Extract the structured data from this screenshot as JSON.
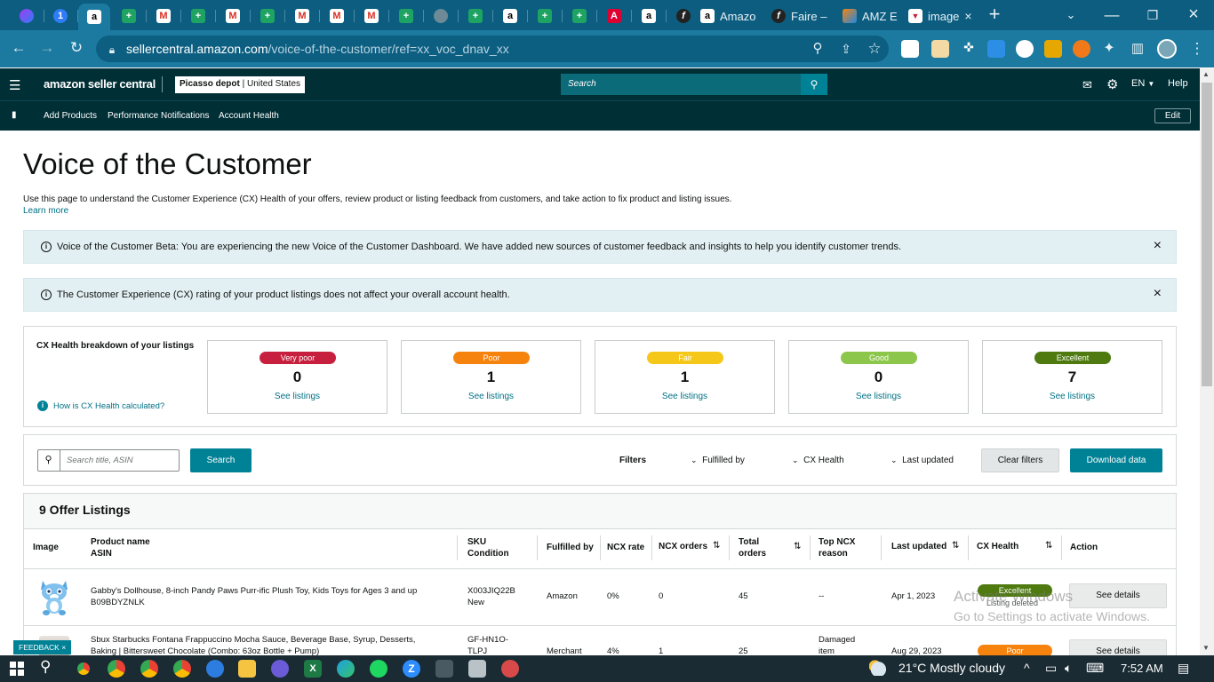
{
  "browser": {
    "tabs": [
      {
        "kind": "icon",
        "icon": "messenger-icon"
      },
      {
        "kind": "icon",
        "icon": "badge-1-icon",
        "text": "1"
      },
      {
        "kind": "icon",
        "icon": "amazon-a-icon",
        "text": "a",
        "active": true
      },
      {
        "kind": "icon",
        "icon": "google-sheets-icon",
        "text": "+"
      },
      {
        "kind": "icon",
        "icon": "gmail-icon",
        "text": "M"
      },
      {
        "kind": "icon",
        "icon": "google-sheets-icon",
        "text": "+"
      },
      {
        "kind": "icon",
        "icon": "gmail-icon",
        "text": "M"
      },
      {
        "kind": "icon",
        "icon": "google-sheets-icon",
        "text": "+"
      },
      {
        "kind": "icon",
        "icon": "gmail-icon",
        "text": "M"
      },
      {
        "kind": "icon",
        "icon": "gmail-icon",
        "text": "M"
      },
      {
        "kind": "icon",
        "icon": "gmail-icon",
        "text": "M"
      },
      {
        "kind": "icon",
        "icon": "google-sheets-icon",
        "text": "+"
      },
      {
        "kind": "icon",
        "icon": "globe-icon"
      },
      {
        "kind": "icon",
        "icon": "google-sheets-icon",
        "text": "+"
      },
      {
        "kind": "icon",
        "icon": "amazon-a-icon",
        "text": "a"
      },
      {
        "kind": "icon",
        "icon": "google-sheets-icon",
        "text": "+"
      },
      {
        "kind": "icon",
        "icon": "google-sheets-icon",
        "text": "+"
      },
      {
        "kind": "icon",
        "icon": "angular-icon",
        "text": "A"
      },
      {
        "kind": "icon",
        "icon": "amazon-a-icon",
        "text": "a"
      },
      {
        "kind": "icon",
        "icon": "faire-f-icon",
        "text": "f"
      }
    ],
    "wide_tabs": [
      {
        "icon": "amazon-a-icon",
        "text": "Amazo"
      },
      {
        "icon": "faire-f-icon",
        "text": "Faire –"
      },
      {
        "icon": "amz-icon",
        "text": "AMZ E"
      },
      {
        "icon": "image-icon",
        "text": "image"
      }
    ],
    "new_tab": "+",
    "url_host": "sellercentral.amazon.com",
    "url_path": "/voice-of-the-customer/ref=xx_voc_dnav_xx"
  },
  "header": {
    "logo": "amazon seller central",
    "account": "Picasso depot",
    "marketplace": "United States",
    "search_placeholder": "Search",
    "language": "EN",
    "help": "Help"
  },
  "nav": {
    "items": [
      "Add Products",
      "Performance Notifications",
      "Account Health"
    ],
    "edit": "Edit"
  },
  "page": {
    "title": "Voice of the Customer",
    "description": "Use this page to understand the Customer Experience (CX) Health of your offers, review product or listing feedback from customers, and take action to fix product and listing issues.",
    "learn_more": "Learn more",
    "banner1": "Voice of the Customer Beta: You are experiencing the new Voice of the Customer Dashboard. We have added new sources of customer feedback and insights to help you identify customer trends.",
    "banner2": "The Customer Experience (CX) rating of your product listings does not affect your overall account health.",
    "close": "×"
  },
  "cx_health": {
    "heading": "CX Health breakdown of your listings",
    "how_link": "How is CX Health calculated?",
    "cards": [
      {
        "label": "Very poor",
        "count": "0",
        "link": "See listings",
        "color": "#c7203e"
      },
      {
        "label": "Poor",
        "count": "1",
        "link": "See listings",
        "color": "#f7830f"
      },
      {
        "label": "Fair",
        "count": "1",
        "link": "See listings",
        "color": "#f5c718"
      },
      {
        "label": "Good",
        "count": "0",
        "link": "See listings",
        "color": "#8cc64a"
      },
      {
        "label": "Excellent",
        "count": "7",
        "link": "See listings",
        "color": "#4e7a10"
      }
    ]
  },
  "filters": {
    "search_placeholder": "Search title, ASIN",
    "search_button": "Search",
    "label": "Filters",
    "fulfilled_by": "Fulfilled by",
    "cx_health": "CX Health",
    "last_updated": "Last updated",
    "clear": "Clear filters",
    "download": "Download data"
  },
  "table": {
    "title": "9 Offer Listings",
    "headers": {
      "image": "Image",
      "product_name": "Product name",
      "asin": "ASIN",
      "sku": "SKU",
      "condition": "Condition",
      "fulfilled_by": "Fulfilled by",
      "ncx_rate": "NCX rate",
      "ncx_orders": "NCX orders",
      "total": "Total",
      "orders": "orders",
      "top_ncx": "Top NCX",
      "reason": "reason",
      "last_updated": "Last updated",
      "cx_health": "CX Health",
      "action": "Action"
    },
    "rows": [
      {
        "name": "Gabby's Dollhouse, 8-inch Pandy Paws Purr-ific Plush Toy, Kids Toys for Ages 3 and up",
        "asin": "B09BDYZNLK",
        "sku": "X003JIQ22B",
        "condition": "New",
        "fulfilled_by": "Amazon",
        "ncx_rate": "0%",
        "ncx_orders": "0",
        "total_orders": "45",
        "top_reason": "--",
        "last_updated": "Apr 1, 2023",
        "cx_health": "Excellent",
        "cx_color": "#4e7a10",
        "status_note": "Listing deleted",
        "action": "See details"
      },
      {
        "name_line1": "Sbux Starbucks Fontana Frappuccino Mocha Sauce, Beverage Base, Syrup, Desserts,",
        "name_line2": "Baking | Bittersweet Chocolate (Combo: 63oz Bottle + Pump)",
        "sku_line1": "GF-HN1O-",
        "sku_line2": "TLPJ",
        "fulfilled_by": "Merchant",
        "ncx_rate": "4%",
        "ncx_orders": "1",
        "total_orders": "25",
        "top_reason_line1": "Damaged",
        "top_reason_line2": "item",
        "last_updated": "Aug 29, 2023",
        "cx_health": "Poor",
        "cx_color": "#f7830f",
        "action": "See details"
      }
    ]
  },
  "feedback": "FEEDBACK",
  "watermark": {
    "line1": "Activate Windows",
    "line2": "Go to Settings to activate Windows."
  },
  "taskbar": {
    "weather": "21°C  Mostly cloudy",
    "time": "7:52 AM"
  }
}
